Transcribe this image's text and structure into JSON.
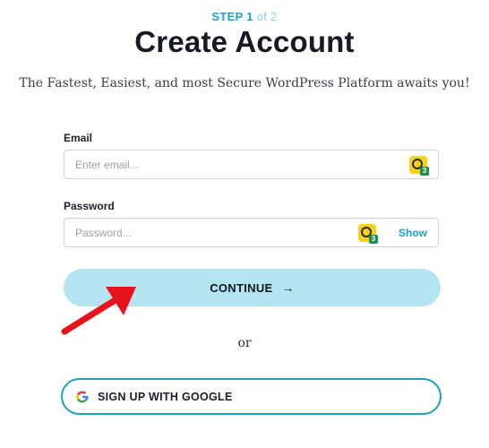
{
  "header": {
    "step_label": "STEP",
    "step_current": "1",
    "step_of": "of 2",
    "title": "Create Account",
    "subtitle": "The Fastest, Easiest, and most Secure WordPress Platform awaits you!"
  },
  "form": {
    "email": {
      "label": "Email",
      "placeholder": "Enter email...",
      "value": ""
    },
    "password": {
      "label": "Password",
      "placeholder": "Password...",
      "value": "",
      "show_label": "Show"
    },
    "password_manager_badge": "3",
    "continue_label": "CONTINUE",
    "continue_arrow": "→"
  },
  "divider": {
    "text": "or"
  },
  "google": {
    "label": "SIGN UP WITH GOOGLE"
  },
  "colors": {
    "accent": "#18a3c7",
    "continue_bg": "#b3e5f1",
    "google_border": "#19a1c4",
    "annotation_arrow": "#e8121a"
  },
  "icons": [
    "password-manager-icon",
    "google-g-icon",
    "arrow-right-icon",
    "annotation-arrow"
  ]
}
